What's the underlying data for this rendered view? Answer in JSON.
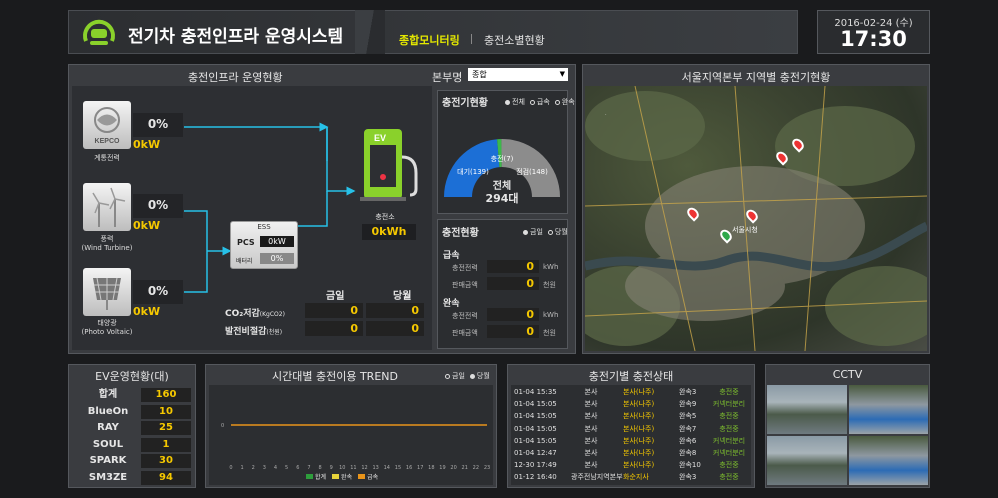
{
  "header": {
    "title": "전기차 충전인프라 운영시스템",
    "tabs": [
      {
        "label": "종합모니터링",
        "active": true
      },
      {
        "label": "충전소별현황",
        "active": false
      }
    ],
    "date": "2016-02-24 (수)",
    "time": "17:30"
  },
  "infra": {
    "title": "충전인프라 운영현황",
    "branch_label": "본부명",
    "branch_select": "종합",
    "sources": [
      {
        "name": "계통전력",
        "percent": "0%",
        "power": "0kW",
        "icon": "kepco-logo-icon",
        "logo_text": "KEPCO"
      },
      {
        "name": "풍력\n(Wind Turbine)",
        "percent": "0%",
        "power": "0kW",
        "icon": "wind-turbine-icon"
      },
      {
        "name": "태양광\n(Photo Voltaic)",
        "percent": "0%",
        "power": "0kW",
        "icon": "solar-panel-icon"
      }
    ],
    "ess": {
      "label": "ESS",
      "pcs_label": "PCS",
      "pcs_value": "0kW",
      "battery_label": "배터리",
      "battery_value": "0%"
    },
    "station": {
      "label": "충전소",
      "value": "0kWh",
      "ev_text": "EV"
    },
    "summary": {
      "col_today": "금일",
      "col_month": "당월",
      "rows": [
        {
          "label": "CO₂저감",
          "unit": "(KgCO2)",
          "today": "0",
          "month": "0"
        },
        {
          "label": "발전비절감",
          "unit": "(천원)",
          "today": "0",
          "month": "0"
        }
      ]
    }
  },
  "charger_status": {
    "title": "충전기현황",
    "legend": [
      "전체",
      "급속",
      "완속"
    ],
    "gauge": {
      "charging": "충전(7)",
      "waiting": "대기(139)",
      "inspect": "점검(148)",
      "total_label": "전체",
      "total": "294대"
    },
    "gauge_values": {
      "charging": 7,
      "waiting": 139,
      "inspect": 148
    }
  },
  "charging_now": {
    "title": "충전현황",
    "legend": [
      "금일",
      "당월"
    ],
    "fast": {
      "title": "급속",
      "rows": [
        {
          "label": "충전전력",
          "value": "0",
          "unit": "kWh"
        },
        {
          "label": "판매금액",
          "value": "0",
          "unit": "천원"
        }
      ]
    },
    "slow": {
      "title": "완속",
      "rows": [
        {
          "label": "충전전력",
          "value": "0",
          "unit": "kWh"
        },
        {
          "label": "판매금액",
          "value": "0",
          "unit": "천원"
        }
      ]
    }
  },
  "map": {
    "title": "서울지역본부 지역별 충전기현황",
    "place_label": "서울시청"
  },
  "ev_ops": {
    "title": "EV운영현황(대)",
    "rows": [
      {
        "label": "합계",
        "value": "160"
      },
      {
        "label": "BlueOn",
        "value": "10"
      },
      {
        "label": "RAY",
        "value": "25"
      },
      {
        "label": "SOUL",
        "value": "1"
      },
      {
        "label": "SPARK",
        "value": "30"
      },
      {
        "label": "SM3ZE",
        "value": "94"
      }
    ]
  },
  "trend": {
    "title": "시간대별 충전이용 TREND",
    "legend": [
      "금일",
      "당월"
    ],
    "series_legend": [
      {
        "name": "합계",
        "color": "#2e9e3c"
      },
      {
        "name": "완속",
        "color": "#e6d23a"
      },
      {
        "name": "급속",
        "color": "#e8941a"
      }
    ],
    "y_tick": "0",
    "x_ticks": [
      "0",
      "1",
      "2",
      "3",
      "4",
      "5",
      "6",
      "7",
      "8",
      "9",
      "10",
      "11",
      "12",
      "13",
      "14",
      "15",
      "16",
      "17",
      "18",
      "19",
      "20",
      "21",
      "22",
      "23"
    ]
  },
  "charger_state": {
    "title": "충전기별 충전상태",
    "rows": [
      {
        "time": "01-04 15:35",
        "org": "본사",
        "place": "본사(나주)",
        "unit": "완속3",
        "status": "충전중"
      },
      {
        "time": "01-04 15:05",
        "org": "본사",
        "place": "본사(나주)",
        "unit": "완속9",
        "status": "커넥터분리"
      },
      {
        "time": "01-04 15:05",
        "org": "본사",
        "place": "본사(나주)",
        "unit": "완속5",
        "status": "충전중"
      },
      {
        "time": "01-04 15:05",
        "org": "본사",
        "place": "본사(나주)",
        "unit": "완속7",
        "status": "충전중"
      },
      {
        "time": "01-04 15:05",
        "org": "본사",
        "place": "본사(나주)",
        "unit": "완속6",
        "status": "커넥터분리"
      },
      {
        "time": "01-04 12:47",
        "org": "본사",
        "place": "본사(나주)",
        "unit": "완속8",
        "status": "커넥터분리"
      },
      {
        "time": "12-30 17:49",
        "org": "본사",
        "place": "본사(나주)",
        "unit": "완속10",
        "status": "충전중"
      },
      {
        "time": "01-12 16:40",
        "org": "광주전남지역본부",
        "place": "화순지사",
        "unit": "완속3",
        "status": "충전중"
      }
    ]
  },
  "cctv": {
    "title": "CCTV"
  },
  "colors": {
    "accent": "#f5c800",
    "green": "#8ad12b",
    "flow": "#27c1e8",
    "gauge_blue": "#1c6fd6",
    "gauge_grey": "#8c8c8c",
    "gauge_green": "#3cb84a"
  }
}
